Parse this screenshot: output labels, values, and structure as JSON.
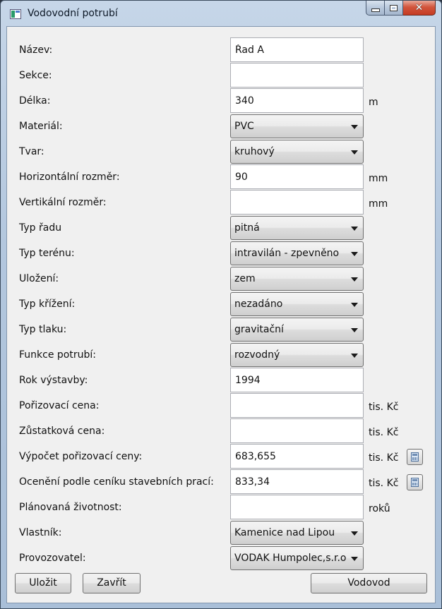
{
  "window": {
    "title": "Vodovodní potrubí"
  },
  "form": {
    "rows": [
      {
        "label": "Název:",
        "type": "text",
        "value": "Řad A",
        "unit": ""
      },
      {
        "label": "Sekce:",
        "type": "text",
        "value": "",
        "unit": ""
      },
      {
        "label": "Délka:",
        "type": "text",
        "value": "340",
        "unit": "m"
      },
      {
        "label": "Materiál:",
        "type": "select",
        "value": "PVC",
        "unit": ""
      },
      {
        "label": "Tvar:",
        "type": "select",
        "value": "kruhový",
        "unit": ""
      },
      {
        "label": "Horizontální rozměr:",
        "type": "text",
        "value": "90",
        "unit": "mm"
      },
      {
        "label": "Vertikální rozměr:",
        "type": "text",
        "value": "",
        "unit": "mm"
      },
      {
        "label": "Typ řadu",
        "type": "select",
        "value": "pitná",
        "unit": ""
      },
      {
        "label": "Typ terénu:",
        "type": "select",
        "value": "intravilán - zpevněno",
        "unit": ""
      },
      {
        "label": "Uložení:",
        "type": "select",
        "value": "zem",
        "unit": ""
      },
      {
        "label": "Typ křížení:",
        "type": "select",
        "value": "nezadáno",
        "unit": ""
      },
      {
        "label": "Typ tlaku:",
        "type": "select",
        "value": "gravitační",
        "unit": ""
      },
      {
        "label": "Funkce potrubí:",
        "type": "select",
        "value": "rozvodný",
        "unit": ""
      },
      {
        "label": "Rok výstavby:",
        "type": "text",
        "value": "1994",
        "unit": ""
      },
      {
        "label": "Pořizovací cena:",
        "type": "text",
        "value": "",
        "unit": "tis. Kč"
      },
      {
        "label": "Zůstatková cena:",
        "type": "text",
        "value": "",
        "unit": "tis. Kč"
      },
      {
        "label": "Výpočet pořizovací ceny:",
        "type": "text",
        "value": "683,655",
        "unit": "tis. Kč",
        "calc": true
      },
      {
        "label": "Ocenění podle ceníku stavebních prací:",
        "type": "text",
        "value": "833,34",
        "unit": "tis. Kč",
        "calc": true
      },
      {
        "label": "Plánovaná životnost:",
        "type": "text",
        "value": "",
        "unit": "roků"
      },
      {
        "label": "Vlastník:",
        "type": "select",
        "value": "Kamenice nad Lipou",
        "unit": ""
      },
      {
        "label": "Provozovatel:",
        "type": "select",
        "value": "VODAK Humpolec,s.r.o.",
        "unit": ""
      }
    ]
  },
  "buttons": {
    "save": "Uložit",
    "close": "Zavřít",
    "vodovod": "Vodovod"
  }
}
